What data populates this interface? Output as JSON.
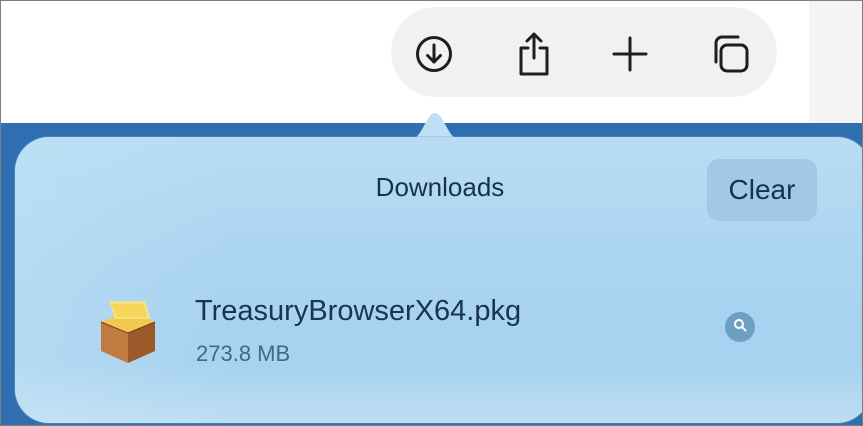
{
  "toolbar": {
    "buttons": [
      {
        "name": "downloads-button",
        "icon": "download-circle-icon"
      },
      {
        "name": "share-button",
        "icon": "share-icon"
      },
      {
        "name": "new-tab-button",
        "icon": "plus-icon"
      },
      {
        "name": "tab-overview-button",
        "icon": "tabs-icon"
      }
    ]
  },
  "popover": {
    "title": "Downloads",
    "clear_label": "Clear"
  },
  "downloads": [
    {
      "file_name": "TreasuryBrowserX64.pkg",
      "file_size": "273.8 MB",
      "icon": "package-icon",
      "action_icon": "magnifier-icon"
    }
  ],
  "colors": {
    "blue_band": "#2f6fb1",
    "popover": "#a9d3f0",
    "text_primary": "#16324a",
    "text_secondary": "#3f6987",
    "accent_button": "#6d9fc3"
  }
}
